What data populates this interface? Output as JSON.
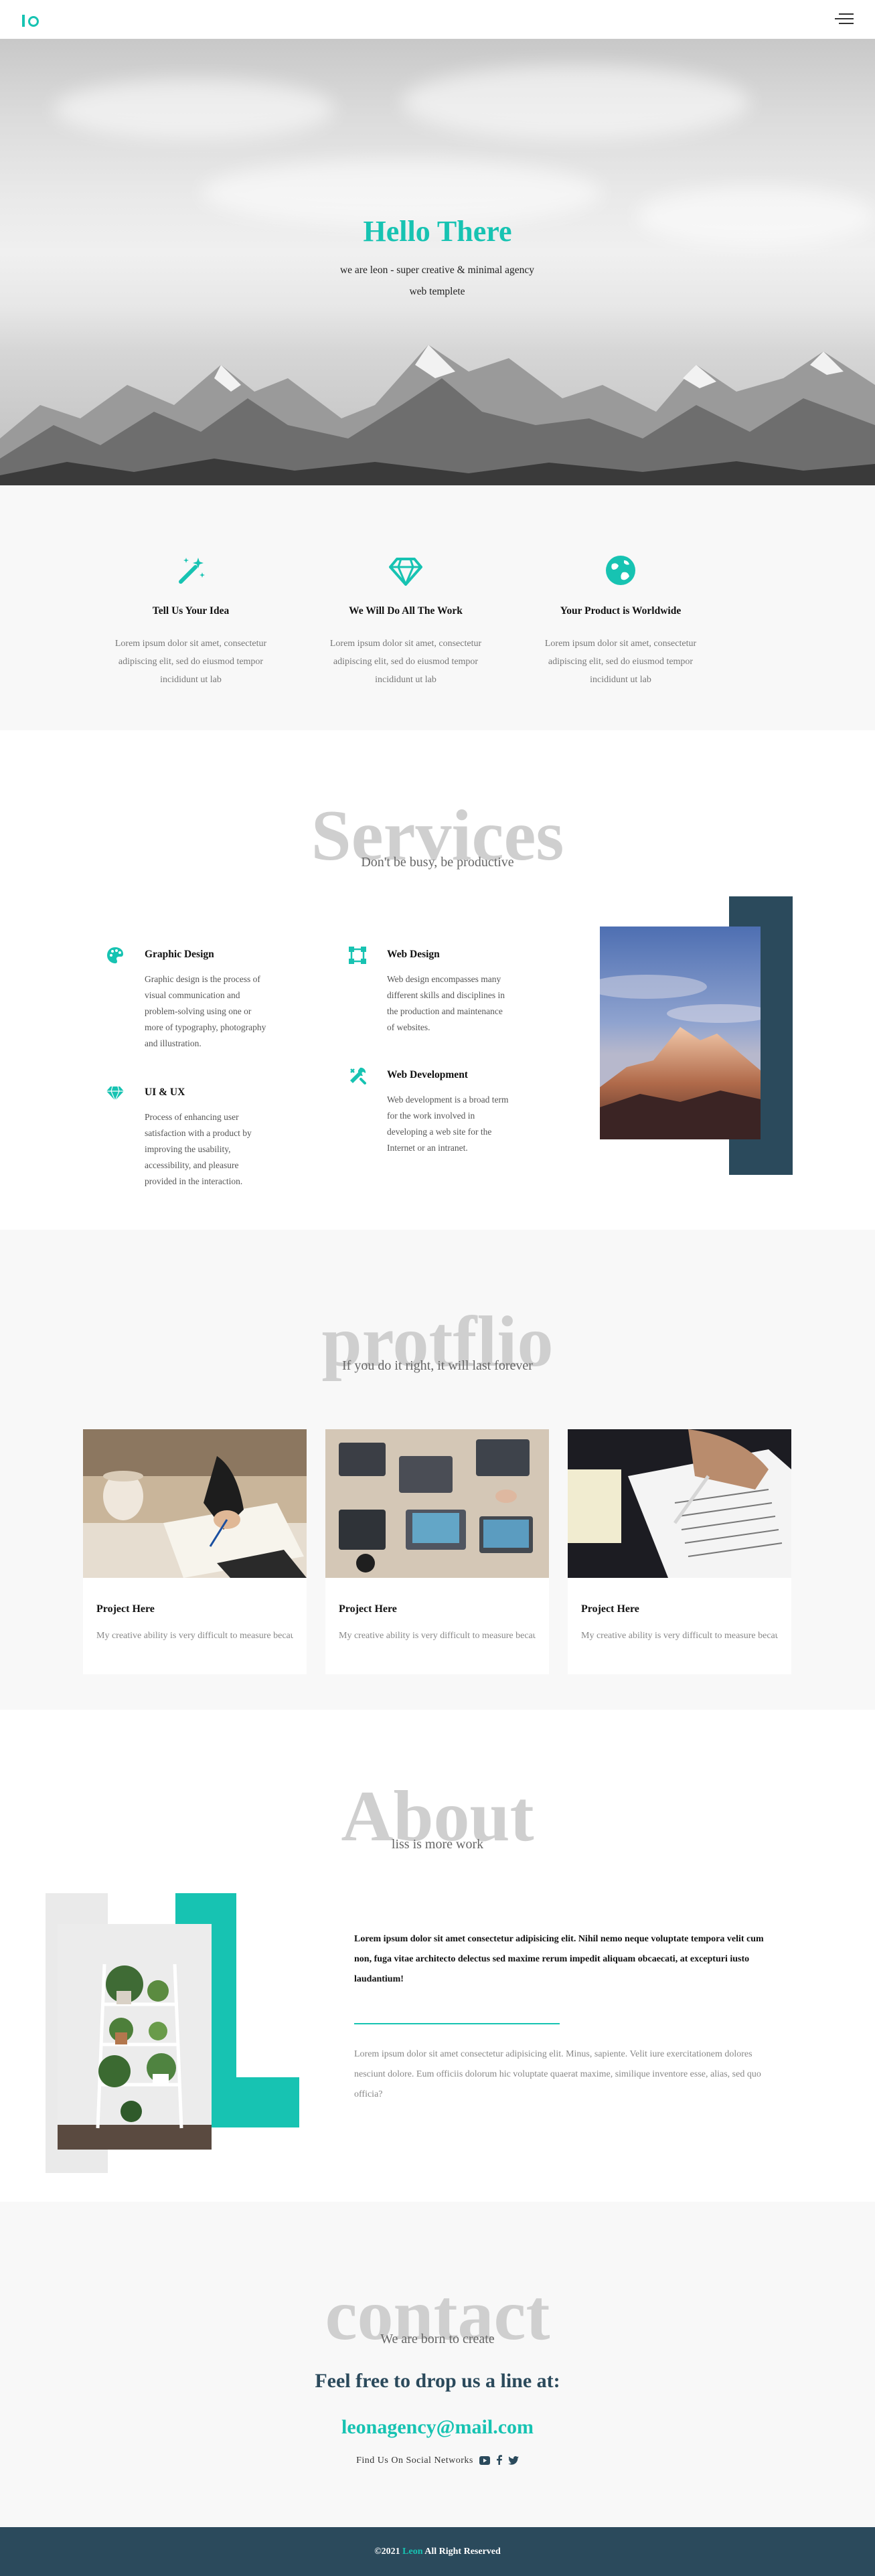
{
  "colors": {
    "accent": "#17c3b2",
    "dark": "#2b4a5c",
    "light_bg": "#f8f8f8"
  },
  "nav": {
    "logo_icon": "logo-io",
    "menu_icon": "hamburger-menu-icon"
  },
  "hero": {
    "title": "Hello There",
    "subtitle": "we are leon - super creative & minimal agency web templete"
  },
  "features": [
    {
      "icon": "magic-wand-icon",
      "title": "Tell Us Your Idea",
      "text": "Lorem ipsum dolor sit amet, consectetur adipiscing elit, sed do eiusmod tempor incididunt ut lab"
    },
    {
      "icon": "diamond-icon",
      "title": "We Will Do All The Work",
      "text": "Lorem ipsum dolor sit amet, consectetur adipiscing elit, sed do eiusmod tempor incididunt ut lab"
    },
    {
      "icon": "globe-icon",
      "title": "Your Product is Worldwide",
      "text": "Lorem ipsum dolor sit amet, consectetur adipiscing elit, sed do eiusmod tempor incididunt ut lab"
    }
  ],
  "services": {
    "heading": "Services",
    "subheading": "Don't be busy, be productive",
    "items": [
      {
        "icon": "palette-icon",
        "title": "Graphic Design",
        "text": "Graphic design is the process of visual communication and problem-solving using one or more of typography, photography and illustration."
      },
      {
        "icon": "vector-square-icon",
        "title": "Web Design",
        "text": "Web design encompasses many different skills and disciplines in the production and maintenance of websites."
      },
      {
        "icon": "gem-icon",
        "title": "UI & UX",
        "text": "Process of enhancing user satisfaction with a product by improving the usability, accessibility, and pleasure provided in the interaction."
      },
      {
        "icon": "tools-icon",
        "title": "Web Development",
        "text": "Web development is a broad term for the work involved in developing a web site for the Internet or an intranet."
      }
    ]
  },
  "portfolio": {
    "heading": "protflio",
    "subheading": "If you do it right, it will last forever",
    "projects": [
      {
        "title": "Project Here",
        "text": "My creative ability is very difficult to measure because it can manifest in so many surprising and"
      },
      {
        "title": "Project Here",
        "text": "My creative ability is very difficult to measure because it can manifest in so many surprising and"
      },
      {
        "title": "Project Here",
        "text": "My creative ability is very difficult to measure because it can manifest in so many surprising and"
      }
    ]
  },
  "about": {
    "heading": "About",
    "subheading": "liss is more work",
    "lead": "Lorem ipsum dolor sit amet consectetur adipisicing elit. Nihil nemo neque voluptate tempora velit cum non, fuga vitae architecto delectus sed maxime rerum impedit aliquam obcaecati, at excepturi iusto laudantium!",
    "text": "Lorem ipsum dolor sit amet consectetur adipisicing elit. Minus, sapiente. Velit iure exercitationem dolores nesciunt dolore. Eum officiis dolorum hic voluptate quaerat maxime, similique inventore esse, alias, sed quo officia?"
  },
  "contact": {
    "heading": "contact",
    "subheading": "We are born to create",
    "line": "Feel free to drop us a line at:",
    "email": "leonagency@mail.com",
    "social_label": "Find Us On Social Networks",
    "social_icons": [
      "youtube-icon",
      "facebook-icon",
      "twitter-icon"
    ]
  },
  "footer": {
    "prefix": "©2021",
    "brand": "Leon",
    "suffix": "All Right Reserved"
  }
}
